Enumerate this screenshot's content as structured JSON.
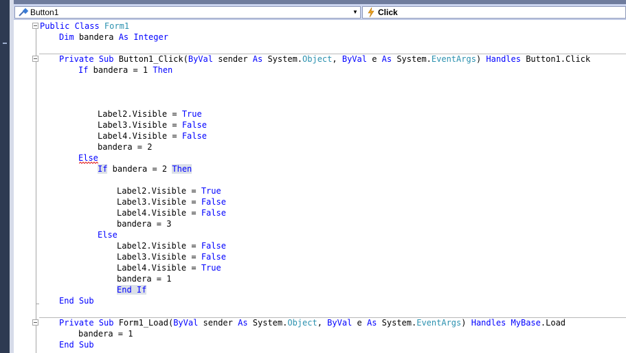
{
  "navigation_bar": {
    "object_combo": "Button1",
    "event_combo": "Click"
  },
  "code_lines": [
    {
      "indent": 0,
      "tokens": [
        {
          "t": "Public Class ",
          "k": "kw"
        },
        {
          "t": "Form1",
          "k": "ty"
        }
      ]
    },
    {
      "indent": 4,
      "tokens": [
        {
          "t": "Dim ",
          "k": "kw"
        },
        {
          "t": "bandera "
        },
        {
          "t": "As Integer",
          "k": "kw"
        }
      ]
    },
    {
      "indent": 0,
      "tokens": []
    },
    {
      "indent": 4,
      "tokens": [
        {
          "t": "Private Sub ",
          "k": "kw"
        },
        {
          "t": "Button1_Click("
        },
        {
          "t": "ByVal",
          "k": "kw"
        },
        {
          "t": " sender "
        },
        {
          "t": "As",
          "k": "kw"
        },
        {
          "t": " System."
        },
        {
          "t": "Object",
          "k": "ty"
        },
        {
          "t": ", "
        },
        {
          "t": "ByVal",
          "k": "kw"
        },
        {
          "t": " e "
        },
        {
          "t": "As",
          "k": "kw"
        },
        {
          "t": " System."
        },
        {
          "t": "EventArgs",
          "k": "ty"
        },
        {
          "t": ") "
        },
        {
          "t": "Handles",
          "k": "kw"
        },
        {
          "t": " Button1.Click"
        }
      ]
    },
    {
      "indent": 8,
      "tokens": [
        {
          "t": "If",
          "k": "kw"
        },
        {
          "t": " bandera = 1 "
        },
        {
          "t": "Then",
          "k": "kw"
        }
      ]
    },
    {
      "indent": 0,
      "tokens": []
    },
    {
      "indent": 0,
      "tokens": []
    },
    {
      "indent": 0,
      "tokens": []
    },
    {
      "indent": 12,
      "tokens": [
        {
          "t": "Label2.Visible = "
        },
        {
          "t": "True",
          "k": "kw"
        }
      ]
    },
    {
      "indent": 12,
      "tokens": [
        {
          "t": "Label3.Visible = "
        },
        {
          "t": "False",
          "k": "kw"
        }
      ]
    },
    {
      "indent": 12,
      "tokens": [
        {
          "t": "Label4.Visible = "
        },
        {
          "t": "False",
          "k": "kw"
        }
      ]
    },
    {
      "indent": 12,
      "tokens": [
        {
          "t": "bandera = 2"
        }
      ]
    },
    {
      "indent": 8,
      "tokens": [
        {
          "t": "Else",
          "k": "kw"
        }
      ]
    },
    {
      "indent": 12,
      "tokens": [
        {
          "t": "If",
          "k": "kw hl"
        },
        {
          "t": " bandera = 2 "
        },
        {
          "t": "Then",
          "k": "kw hl"
        }
      ]
    },
    {
      "indent": 0,
      "tokens": []
    },
    {
      "indent": 16,
      "tokens": [
        {
          "t": "Label2.Visible = "
        },
        {
          "t": "True",
          "k": "kw"
        }
      ]
    },
    {
      "indent": 16,
      "tokens": [
        {
          "t": "Label3.Visible = "
        },
        {
          "t": "False",
          "k": "kw"
        }
      ]
    },
    {
      "indent": 16,
      "tokens": [
        {
          "t": "Label4.Visible = "
        },
        {
          "t": "False",
          "k": "kw"
        }
      ]
    },
    {
      "indent": 16,
      "tokens": [
        {
          "t": "bandera = 3"
        }
      ]
    },
    {
      "indent": 12,
      "tokens": [
        {
          "t": "Else",
          "k": "kw"
        }
      ]
    },
    {
      "indent": 16,
      "tokens": [
        {
          "t": "Label2.Visible = "
        },
        {
          "t": "False",
          "k": "kw"
        }
      ]
    },
    {
      "indent": 16,
      "tokens": [
        {
          "t": "Label3.Visible = "
        },
        {
          "t": "False",
          "k": "kw"
        }
      ]
    },
    {
      "indent": 16,
      "tokens": [
        {
          "t": "Label4.Visible = "
        },
        {
          "t": "True",
          "k": "kw"
        }
      ]
    },
    {
      "indent": 16,
      "tokens": [
        {
          "t": "bandera = 1"
        }
      ]
    },
    {
      "indent": 16,
      "tokens": [
        {
          "t": "End If",
          "k": "kw hl"
        }
      ]
    },
    {
      "indent": 4,
      "tokens": [
        {
          "t": "End Sub",
          "k": "kw"
        }
      ]
    },
    {
      "indent": 0,
      "tokens": []
    },
    {
      "indent": 4,
      "tokens": [
        {
          "t": "Private Sub ",
          "k": "kw"
        },
        {
          "t": "Form1_Load("
        },
        {
          "t": "ByVal",
          "k": "kw"
        },
        {
          "t": " sender "
        },
        {
          "t": "As",
          "k": "kw"
        },
        {
          "t": " System."
        },
        {
          "t": "Object",
          "k": "ty"
        },
        {
          "t": ", "
        },
        {
          "t": "ByVal",
          "k": "kw"
        },
        {
          "t": " e "
        },
        {
          "t": "As",
          "k": "kw"
        },
        {
          "t": " System."
        },
        {
          "t": "EventArgs",
          "k": "ty"
        },
        {
          "t": ") "
        },
        {
          "t": "Handles",
          "k": "kw"
        },
        {
          "t": " "
        },
        {
          "t": "MyBase",
          "k": "kw"
        },
        {
          "t": ".Load"
        }
      ]
    },
    {
      "indent": 8,
      "tokens": [
        {
          "t": "bandera = 1"
        }
      ]
    },
    {
      "indent": 4,
      "tokens": [
        {
          "t": "End Sub",
          "k": "kw"
        }
      ]
    }
  ]
}
